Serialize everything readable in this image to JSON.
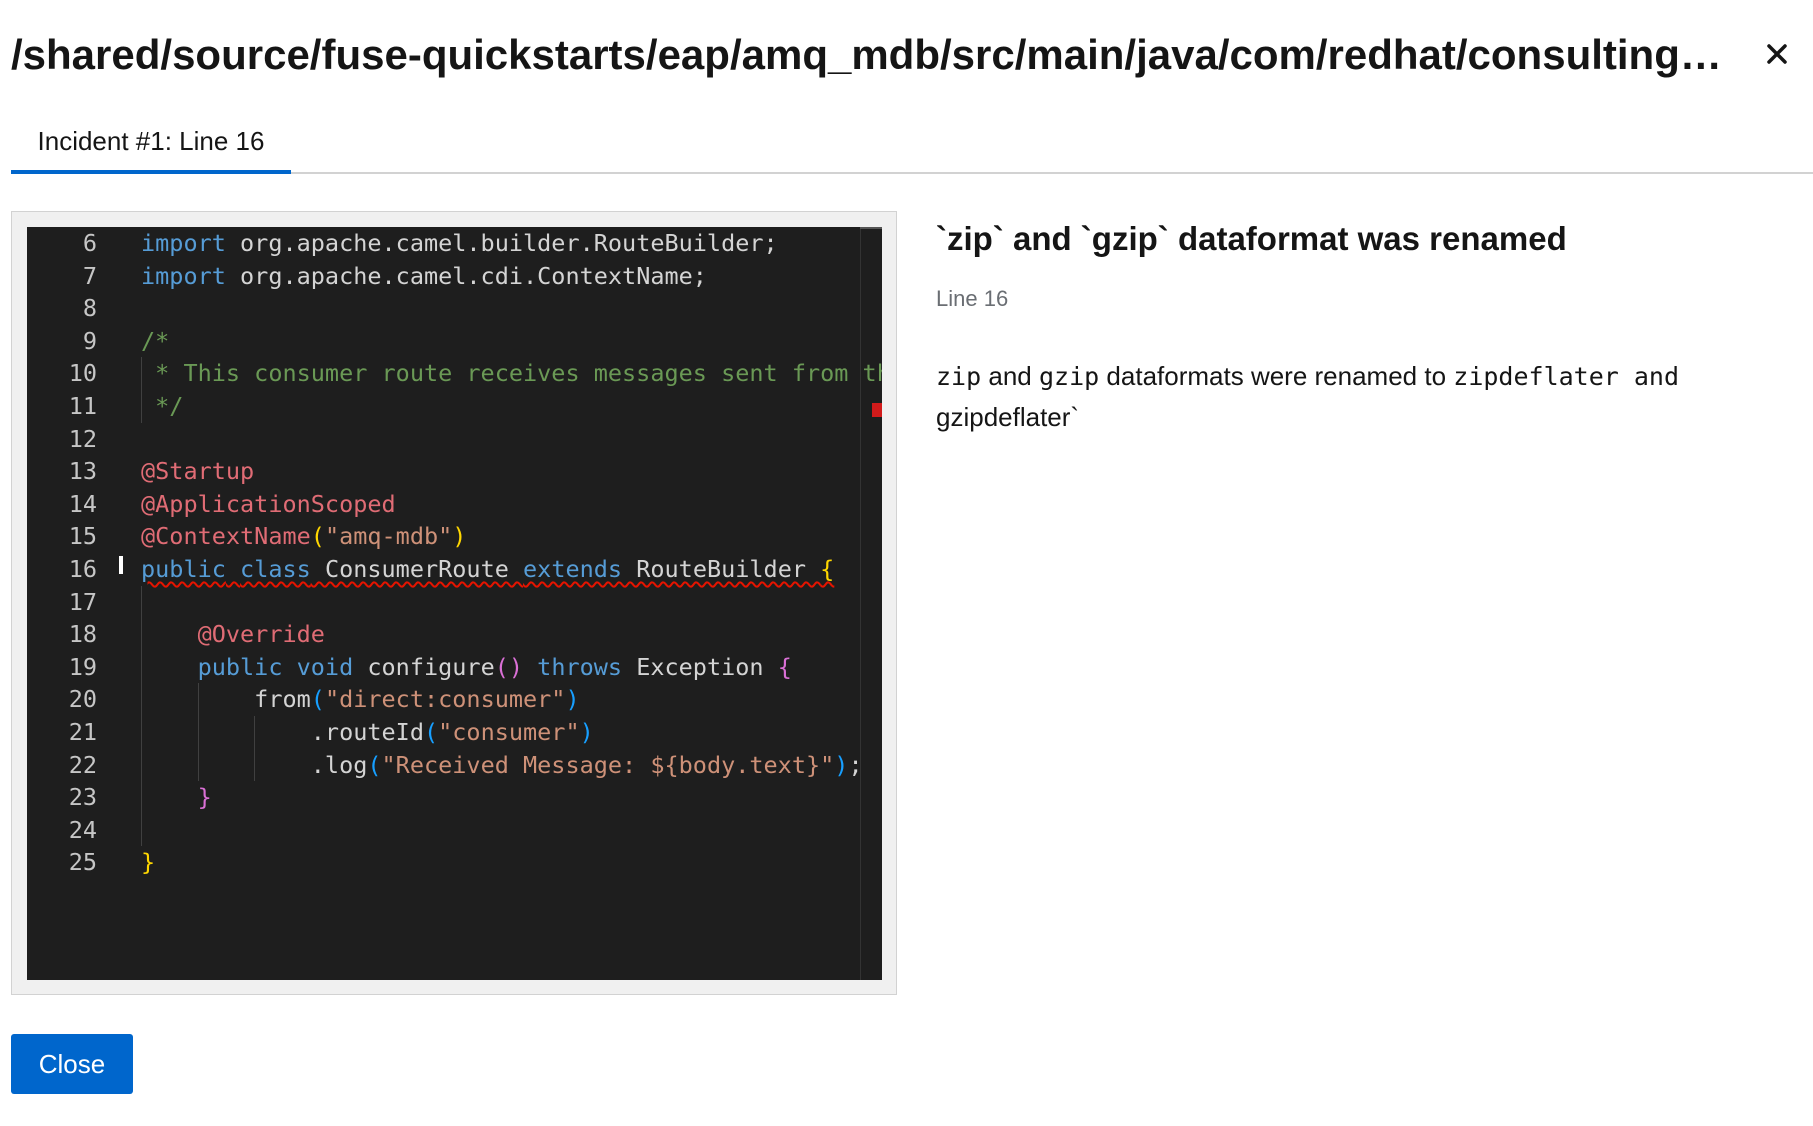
{
  "modal": {
    "title": "/shared/source/fuse-quickstarts/eap/amq_mdb/src/main/java/com/redhat/consulting/fuse...",
    "close_icon": "close-icon"
  },
  "tabs": [
    {
      "label": "Incident #1: Line 16",
      "active": true
    }
  ],
  "editor": {
    "lines": [
      {
        "n": "6",
        "segs": [
          [
            "kw",
            "import"
          ],
          [
            "p",
            " org.apache.camel.builder.RouteBuilder;"
          ]
        ]
      },
      {
        "n": "7",
        "segs": [
          [
            "kw",
            "import"
          ],
          [
            "p",
            " org.apache.camel.cdi.ContextName;"
          ]
        ]
      },
      {
        "n": "8",
        "segs": []
      },
      {
        "n": "9",
        "segs": [
          [
            "cm",
            "/*"
          ]
        ]
      },
      {
        "n": "10",
        "segs": [
          [
            "cm",
            " * This consumer route receives messages sent from th"
          ]
        ]
      },
      {
        "n": "11",
        "segs": [
          [
            "cm",
            " */"
          ]
        ]
      },
      {
        "n": "12",
        "segs": []
      },
      {
        "n": "13",
        "segs": [
          [
            "an",
            "@Startup"
          ]
        ]
      },
      {
        "n": "14",
        "segs": [
          [
            "an",
            "@ApplicationScoped"
          ]
        ]
      },
      {
        "n": "15",
        "segs": [
          [
            "an",
            "@ContextName"
          ],
          [
            "br-y",
            "("
          ],
          [
            "st",
            "\"amq-mdb\""
          ],
          [
            "br-y",
            ")"
          ]
        ]
      },
      {
        "n": "16",
        "segs": [
          [
            "kw sq",
            "public"
          ],
          [
            "p sq",
            " "
          ],
          [
            "kw sq",
            "class"
          ],
          [
            "p sq",
            " ConsumerRoute "
          ],
          [
            "kw sq",
            "extends"
          ],
          [
            "p sq",
            " RouteBuilder "
          ],
          [
            "br-y sq",
            "{"
          ]
        ]
      },
      {
        "n": "17",
        "segs": []
      },
      {
        "n": "18",
        "segs": [
          [
            "p",
            "    "
          ],
          [
            "an",
            "@Override"
          ]
        ]
      },
      {
        "n": "19",
        "segs": [
          [
            "p",
            "    "
          ],
          [
            "kw",
            "public"
          ],
          [
            "p",
            " "
          ],
          [
            "kw",
            "void"
          ],
          [
            "p",
            " configure"
          ],
          [
            "br-p",
            "()"
          ],
          [
            "p",
            " "
          ],
          [
            "kw",
            "throws"
          ],
          [
            "p",
            " Exception "
          ],
          [
            "br-p",
            "{"
          ]
        ]
      },
      {
        "n": "20",
        "segs": [
          [
            "p",
            "        from"
          ],
          [
            "br-b",
            "("
          ],
          [
            "st",
            "\"direct:consumer\""
          ],
          [
            "br-b",
            ")"
          ]
        ]
      },
      {
        "n": "21",
        "segs": [
          [
            "p",
            "            .routeId"
          ],
          [
            "br-b",
            "("
          ],
          [
            "st",
            "\"consumer\""
          ],
          [
            "br-b",
            ")"
          ]
        ]
      },
      {
        "n": "22",
        "segs": [
          [
            "p",
            "            .log"
          ],
          [
            "br-b",
            "("
          ],
          [
            "st",
            "\"Received Message: ${body.text}\""
          ],
          [
            "br-b",
            ")"
          ],
          [
            "p",
            ";"
          ]
        ]
      },
      {
        "n": "23",
        "segs": [
          [
            "p",
            "    "
          ],
          [
            "br-p",
            "}"
          ]
        ]
      },
      {
        "n": "24",
        "segs": []
      },
      {
        "n": "25",
        "segs": [
          [
            "br-y",
            "}"
          ]
        ]
      }
    ]
  },
  "incident": {
    "title": "`zip` and `gzip` dataformat was renamed",
    "line_label": "Line 16",
    "body_zip": "zip",
    "body_and1": " and ",
    "body_gzip": "gzip",
    "body_mid": " dataformats were renamed to ",
    "body_zipdeflater": "zipdeflater and",
    "body_end": "gzipdeflater`"
  },
  "footer": {
    "close_label": "Close"
  },
  "colors": {
    "accent": "#0066cc",
    "editor_bg": "#1e1e1e",
    "error": "#e51400"
  }
}
